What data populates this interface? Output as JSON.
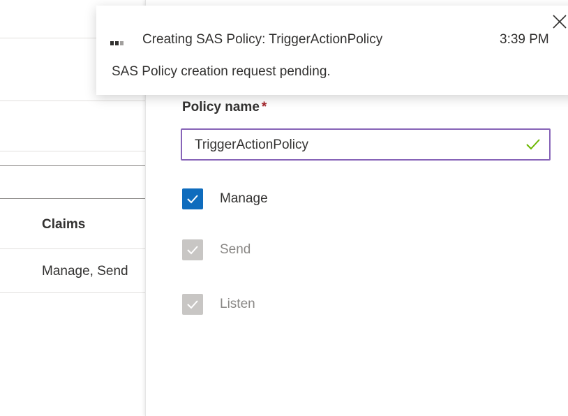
{
  "background_table": {
    "column_header": "Claims",
    "row_value": "Manage, Send"
  },
  "panel": {
    "policy_name_label": "Policy name",
    "required_marker": "*",
    "policy_name_value": "TriggerActionPolicy",
    "checkboxes": [
      {
        "label": "Manage",
        "checked": true,
        "disabled": false
      },
      {
        "label": "Send",
        "checked": true,
        "disabled": true
      },
      {
        "label": "Listen",
        "checked": true,
        "disabled": true
      }
    ]
  },
  "notification": {
    "title": "Creating SAS Policy: TriggerActionPolicy",
    "time": "3:39 PM",
    "message": "SAS Policy creation request pending."
  },
  "colors": {
    "accent": "#0f6cbd",
    "input_border_focus": "#8764b8",
    "valid_check": "#6bb700",
    "required": "#a4262c"
  },
  "icons": {
    "close": "close-icon",
    "valid": "checkmark-icon",
    "progress": "progress-dots-icon"
  }
}
